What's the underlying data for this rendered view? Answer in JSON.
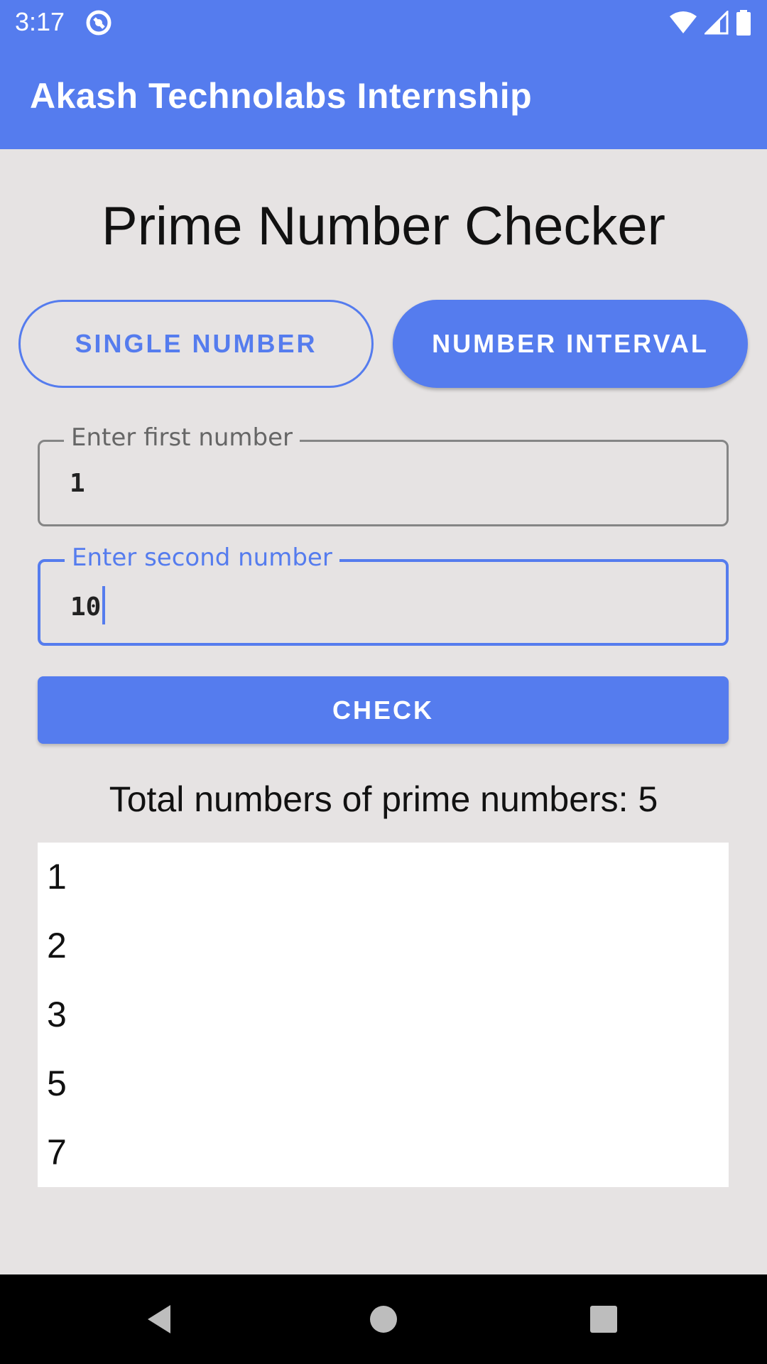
{
  "status_bar": {
    "time": "3:17",
    "icons": [
      "app-notification-icon",
      "wifi-icon",
      "cell-signal-icon",
      "battery-icon"
    ]
  },
  "app_bar": {
    "title": "Akash Technolabs Internship",
    "color": "#557cee"
  },
  "main": {
    "title": "Prime Number Checker",
    "mode_buttons": {
      "single_label": "SINGLE NUMBER",
      "interval_label": "NUMBER INTERVAL",
      "selected": "NUMBER INTERVAL"
    },
    "first_field": {
      "label": "Enter first number",
      "value": "1"
    },
    "second_field": {
      "label": "Enter second number",
      "value": "10"
    },
    "check_label": "CHECK",
    "result_count": "Total numbers of prime numbers: 5",
    "results": [
      "1",
      "2",
      "3",
      "5",
      "7"
    ]
  },
  "nav_bar": {
    "icons": [
      "back-icon",
      "home-icon",
      "recents-icon"
    ]
  }
}
